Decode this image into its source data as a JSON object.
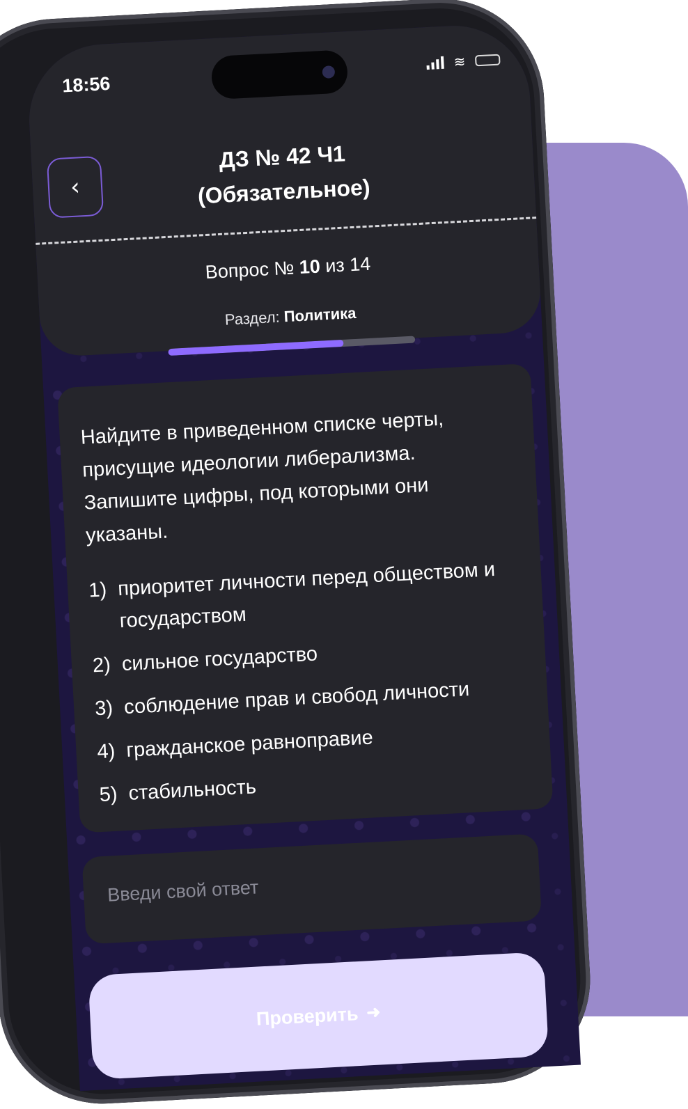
{
  "status": {
    "time": "18:56"
  },
  "header": {
    "title_line1": "ДЗ № 42 Ч1",
    "title_line2": "(Обязательное)",
    "question_prefix": "Вопрос № ",
    "question_current": "10",
    "question_suffix": " из 14",
    "section_label": "Раздел: ",
    "section_value": "Политика",
    "progress_fraction": 0.71
  },
  "question": {
    "text": "Найдите в приведенном списке черты, присущие идеологии либерализма. Запишите цифры, под которыми они указаны.",
    "options": [
      {
        "num": "1)",
        "text": "приоритет личности перед обществом и государством"
      },
      {
        "num": "2)",
        "text": "сильное государство"
      },
      {
        "num": "3)",
        "text": "соблюдение прав и свобод личности"
      },
      {
        "num": "4)",
        "text": "гражданское равноправие"
      },
      {
        "num": "5)",
        "text": "стабильность"
      }
    ]
  },
  "answer": {
    "placeholder": "Введи свой ответ",
    "value": ""
  },
  "check_button": {
    "label": "Проверить"
  },
  "colors": {
    "accent": "#8e6bff",
    "background_card": "#9a8acb",
    "panel": "#25252b",
    "button": "#e2daff"
  }
}
